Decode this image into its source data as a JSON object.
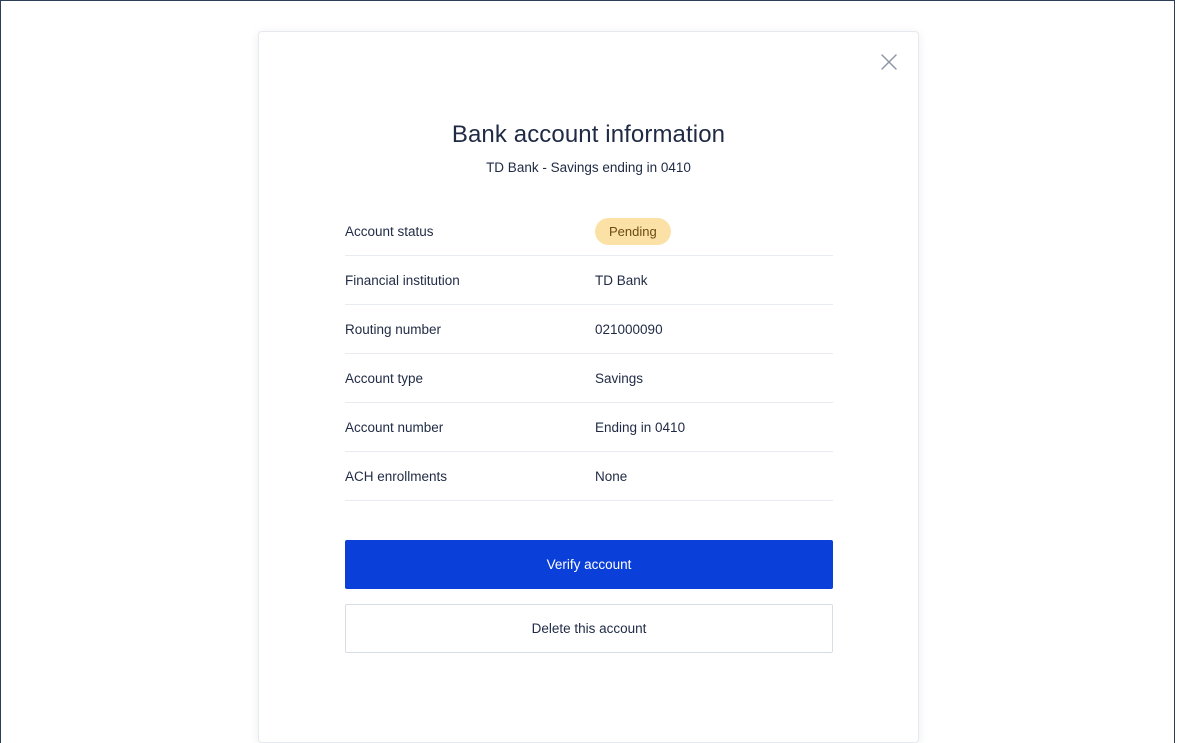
{
  "modal": {
    "title": "Bank account information",
    "subtitle": "TD Bank - Savings ending in 0410",
    "close_icon": "close-icon",
    "details": [
      {
        "label": "Account status",
        "value": "Pending",
        "type": "badge"
      },
      {
        "label": "Financial institution",
        "value": "TD Bank"
      },
      {
        "label": "Routing number",
        "value": "021000090"
      },
      {
        "label": "Account type",
        "value": "Savings"
      },
      {
        "label": "Account number",
        "value": "Ending in 0410"
      },
      {
        "label": "ACH enrollments",
        "value": "None"
      }
    ],
    "actions": {
      "primary_label": "Verify account",
      "secondary_label": "Delete this account"
    }
  },
  "colors": {
    "primary": "#0a3fd9",
    "status_pending_bg": "#fbe1a6",
    "text": "#1f2a44",
    "divider": "#e8ebef"
  }
}
